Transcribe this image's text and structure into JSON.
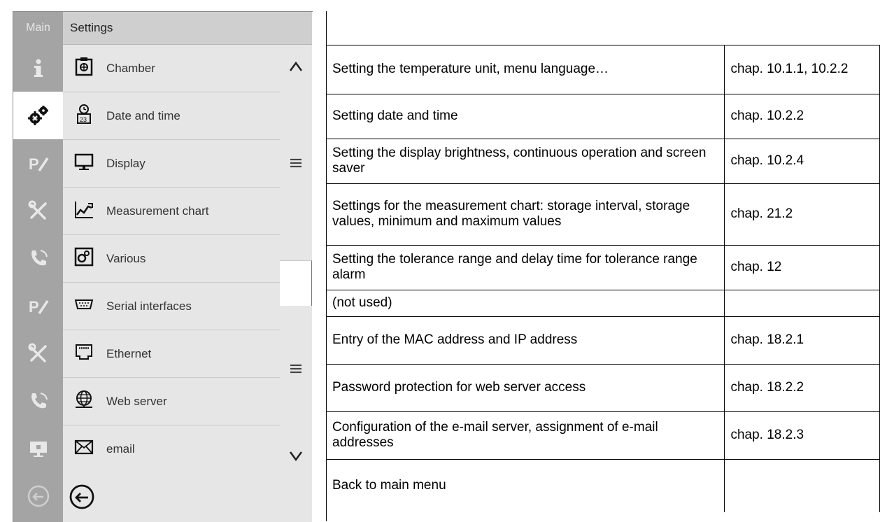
{
  "left_strip": {
    "main_label": "Main",
    "icons": [
      "info-icon",
      "settings-gears-icon",
      "user-levels-icon",
      "service-tools-icon",
      "service-phone-icon",
      "user-levels-icon",
      "service-tools-icon",
      "service-phone-icon",
      "display-monitor-icon",
      "back-icon"
    ]
  },
  "settings": {
    "title": "Settings",
    "items": [
      {
        "label": "Chamber",
        "icon": "chamber-icon"
      },
      {
        "label": "Date and time",
        "icon": "clock-calendar-icon"
      },
      {
        "label": "Display",
        "icon": "monitor-icon"
      },
      {
        "label": "Measurement chart",
        "icon": "chart-icon"
      },
      {
        "label": "Various",
        "icon": "gears-icon"
      },
      {
        "label": "Serial interfaces",
        "icon": "serial-port-icon"
      },
      {
        "label": "Ethernet",
        "icon": "ethernet-port-icon"
      },
      {
        "label": "Web server",
        "icon": "globe-icon"
      },
      {
        "label": "email",
        "icon": "envelope-icon"
      }
    ]
  },
  "table": {
    "rows": [
      {
        "desc": "",
        "chap": ""
      },
      {
        "desc": "Setting the temperature unit, menu language…",
        "chap": "chap. 10.1.1, 10.2.2"
      },
      {
        "desc": "Setting date and time",
        "chap": "chap. 10.2.2"
      },
      {
        "desc": "Setting the display brightness, continuous operation and screen saver",
        "chap": "chap. 10.2.4"
      },
      {
        "desc": "Settings for the measurement chart: storage interval, storage values, minimum and maximum values",
        "chap": "chap. 21.2"
      },
      {
        "desc": "Setting the tolerance range and delay time for tolerance range alarm",
        "chap": "chap. 12"
      },
      {
        "desc": "(not used)",
        "chap": ""
      },
      {
        "desc": "Entry of the MAC address and IP address",
        "chap": "chap. 18.2.1"
      },
      {
        "desc": "Password protection for web server access",
        "chap": "chap. 18.2.2"
      },
      {
        "desc": "Configuration of the e-mail server, assignment of e-mail addresses",
        "chap": "chap. 18.2.3"
      },
      {
        "desc": "Back to main menu",
        "chap": ""
      }
    ]
  }
}
